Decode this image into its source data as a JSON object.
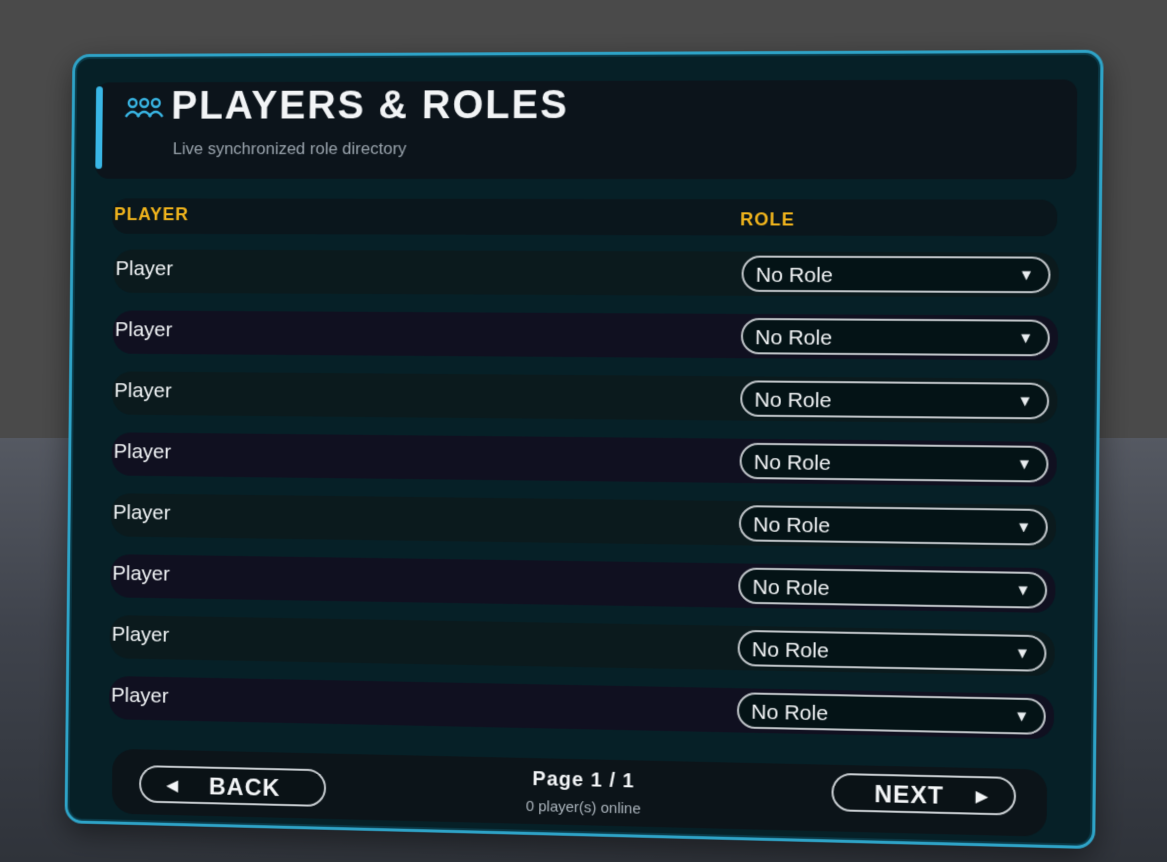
{
  "header": {
    "title": "PLAYERS & ROLES",
    "subtitle": "Live synchronized role directory",
    "icon": "players-group-icon",
    "accent_color": "#39b7e6"
  },
  "columns": {
    "player": "PLAYER",
    "role": "ROLE",
    "header_color": "#f2b51c"
  },
  "rows": [
    {
      "name": "Player",
      "role": "No Role"
    },
    {
      "name": "Player",
      "role": "No Role"
    },
    {
      "name": "Player",
      "role": "No Role"
    },
    {
      "name": "Player",
      "role": "No Role"
    },
    {
      "name": "Player",
      "role": "No Role"
    },
    {
      "name": "Player",
      "role": "No Role"
    },
    {
      "name": "Player",
      "role": "No Role"
    },
    {
      "name": "Player",
      "role": "No Role"
    }
  ],
  "footer": {
    "back_label": "BACK",
    "next_label": "NEXT",
    "page_text": "Page 1 / 1",
    "online_text": "0 player(s) online"
  },
  "colors": {
    "panel_border": "#2ea3c7",
    "panel_bg": "#062027"
  }
}
